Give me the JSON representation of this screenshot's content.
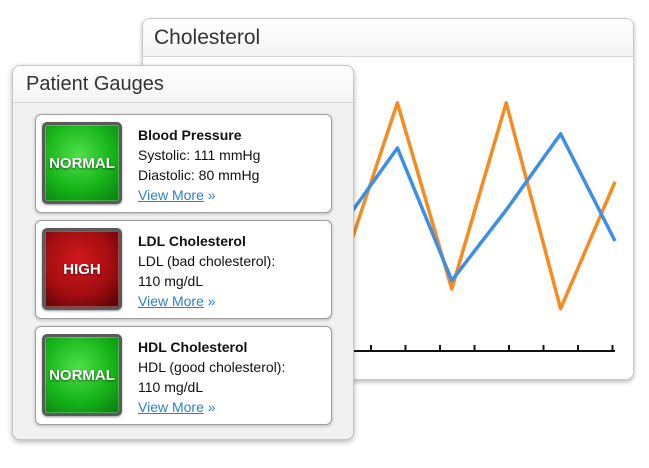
{
  "chart_panel": {
    "title": "Cholesterol"
  },
  "chart_data": {
    "type": "line",
    "series": [
      {
        "color": "#f68b1f",
        "values": [
          0.7,
          0.12,
          0.78,
          0.12,
          0.85,
          0.4
        ]
      },
      {
        "color": "#3d8ee8",
        "values": [
          0.55,
          0.28,
          0.75,
          0.5,
          0.23,
          0.61
        ]
      }
    ],
    "grid": false
  },
  "gauges_panel": {
    "title": "Patient Gauges",
    "cards": [
      {
        "status": "NORMAL",
        "status_color": "green",
        "title": "Blood Pressure",
        "line1": "Systolic: 111 mmHg",
        "line2": "Diastolic: 80 mmHg",
        "link": "View More",
        "link_arrow": "»"
      },
      {
        "status": "HIGH",
        "status_color": "red",
        "title": "LDL Cholesterol",
        "line1": "LDL (bad cholesterol):",
        "line2": "110 mg/dL",
        "link": "View More",
        "link_arrow": "»"
      },
      {
        "status": "NORMAL",
        "status_color": "green",
        "title": "HDL Cholesterol",
        "line1": "HDL (good cholesterol):",
        "line2": "110 mg/dL",
        "link": "View More",
        "link_arrow": "»"
      }
    ]
  }
}
